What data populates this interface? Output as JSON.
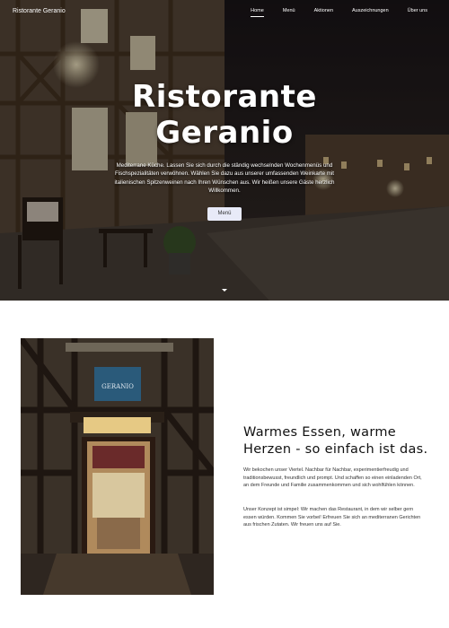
{
  "header": {
    "brand": "Ristorante Geranio",
    "nav": [
      {
        "label": "Home",
        "active": true
      },
      {
        "label": "Menü",
        "active": false
      },
      {
        "label": "Aktionen",
        "active": false
      },
      {
        "label": "Auszeichnungen",
        "active": false
      },
      {
        "label": "Über uns",
        "active": false
      }
    ]
  },
  "hero": {
    "title_line1": "Ristorante",
    "title_line2": "Geranio",
    "text": "Mediterrane Küche. Lassen Sie sich durch die ständig wechselnden Wochenmenüs und Fischspezialitäten verwöhnen. Wählen Sie dazu aus unserer umfassenden Weinkarte mit italienischen Spitzenweinen nach Ihren Wünschen aus. Wir heißen unsere Gäste herzlich Willkommen.",
    "button_label": "Menü",
    "signage": "GERANIO"
  },
  "about": {
    "title": "Warmes Essen, warme Herzen - so einfach ist das.",
    "paragraph1": "Wir bekochen unser Viertel. Nachbar für Nachbar, experimentierfreudig und traditionsbewusst, freundlich und prompt. Und schaffen so einen einladenden Ort, an dem Freunde und Familie zusammenkommen und sich wohlfühlen können.",
    "paragraph2": "Unser Konzept ist simpel: Wir machen das Restaurant, in dem wir selber gern essen würden. Kommen Sie vorbei! Erfreuen Sie sich an mediterranen Gerichten aus frischen Zutaten. Wir freuen uns auf Sie."
  },
  "colors": {
    "hero_overlay": "#1a1512",
    "button_bg": "#e8eaf8",
    "title_text": "#111111"
  }
}
